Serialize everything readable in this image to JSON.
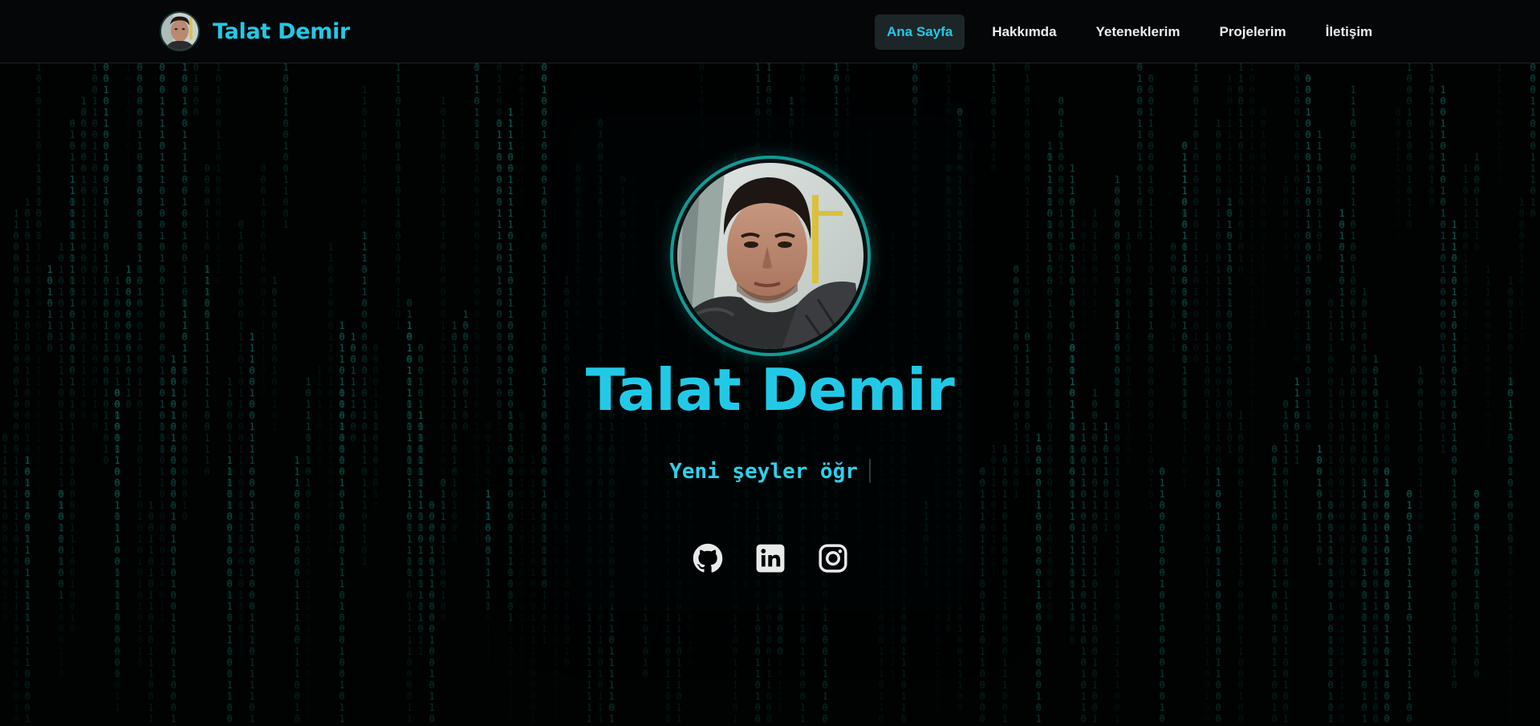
{
  "brand": {
    "name": "Talat Demir"
  },
  "nav": {
    "items": [
      {
        "label": "Ana Sayfa",
        "active": true
      },
      {
        "label": "Hakkımda",
        "active": false
      },
      {
        "label": "Yeteneklerim",
        "active": false
      },
      {
        "label": "Projelerim",
        "active": false
      },
      {
        "label": "İletişim",
        "active": false
      }
    ]
  },
  "hero": {
    "name": "Talat Demir",
    "typed_text": "Yeni şeyler öğr"
  },
  "socials": [
    {
      "icon": "github-icon"
    },
    {
      "icon": "linkedin-icon"
    },
    {
      "icon": "instagram-icon"
    }
  ],
  "colors": {
    "accent": "#22c9e6",
    "matrix": "#1fa894",
    "ring": "#129b94",
    "background": "#010202"
  }
}
